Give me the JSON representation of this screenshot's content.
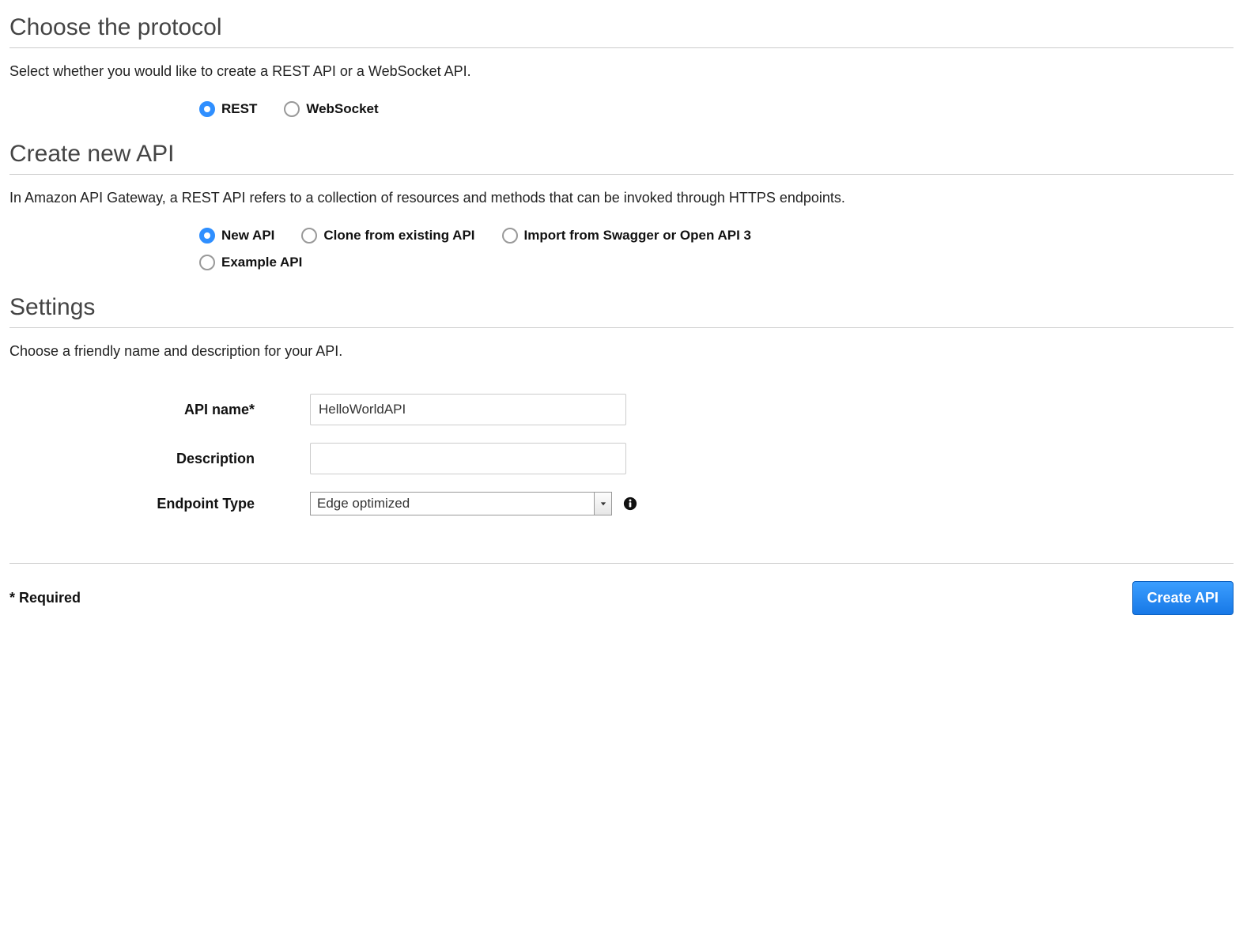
{
  "protocol": {
    "heading": "Choose the protocol",
    "description": "Select whether you would like to create a REST API or a WebSocket API.",
    "options": {
      "rest": "REST",
      "websocket": "WebSocket"
    },
    "selected": "rest"
  },
  "createApi": {
    "heading": "Create new API",
    "description": "In Amazon API Gateway, a REST API refers to a collection of resources and methods that can be invoked through HTTPS endpoints.",
    "options": {
      "new": "New API",
      "clone": "Clone from existing API",
      "import": "Import from Swagger or Open API 3",
      "example": "Example API"
    },
    "selected": "new"
  },
  "settings": {
    "heading": "Settings",
    "description": "Choose a friendly name and description for your API.",
    "fields": {
      "apiName": {
        "label": "API name*",
        "value": "HelloWorldAPI"
      },
      "description": {
        "label": "Description",
        "value": ""
      },
      "endpointType": {
        "label": "Endpoint Type",
        "value": "Edge optimized"
      }
    }
  },
  "footer": {
    "requiredNote": "* Required",
    "createButton": "Create API"
  }
}
